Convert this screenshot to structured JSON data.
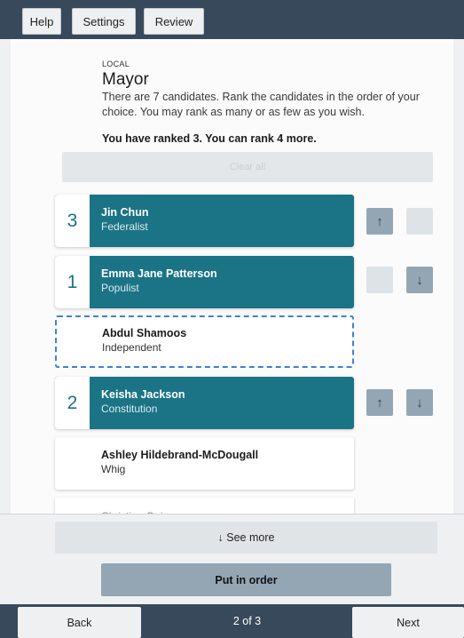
{
  "topbar": {
    "help_label": "Help",
    "settings_label": "Settings",
    "review_label": "Review"
  },
  "contest": {
    "category": "LOCAL",
    "title": "Mayor",
    "instructions": "There are 7 candidates. Rank the candidates in the order of your choice. You may rank as many or as few as you wish.",
    "ranked_status": "You have ranked 3. You can rank 4 more.",
    "clear_label": "Clear all"
  },
  "candidates": [
    {
      "rank": "3",
      "name": "Jin Chun",
      "party": "Federalist"
    },
    {
      "rank": "1",
      "name": "Emma Jane Patterson",
      "party": "Populist"
    },
    {
      "rank": "",
      "name": "Abdul Shamoos",
      "party": "Independent"
    },
    {
      "rank": "2",
      "name": "Keisha Jackson",
      "party": "Constitution"
    },
    {
      "rank": "",
      "name": "Ashley Hildebrand-McDougall",
      "party": "Whig"
    }
  ],
  "partial_candidate": "Christina Gaines",
  "actions": {
    "see_more_label": "↓ See more",
    "put_in_order_label": "Put in order"
  },
  "footer": {
    "back_label": "Back",
    "page_indicator": "2 of 3",
    "next_label": "Next"
  },
  "colors": {
    "header_bg": "#38495b",
    "ranked_bg": "#1b7386",
    "arrow_btn": "#94a6b4",
    "selected_outline": "#3f7fd9"
  },
  "icons": {
    "up": "arrow-up-icon",
    "down": "arrow-down-icon"
  }
}
